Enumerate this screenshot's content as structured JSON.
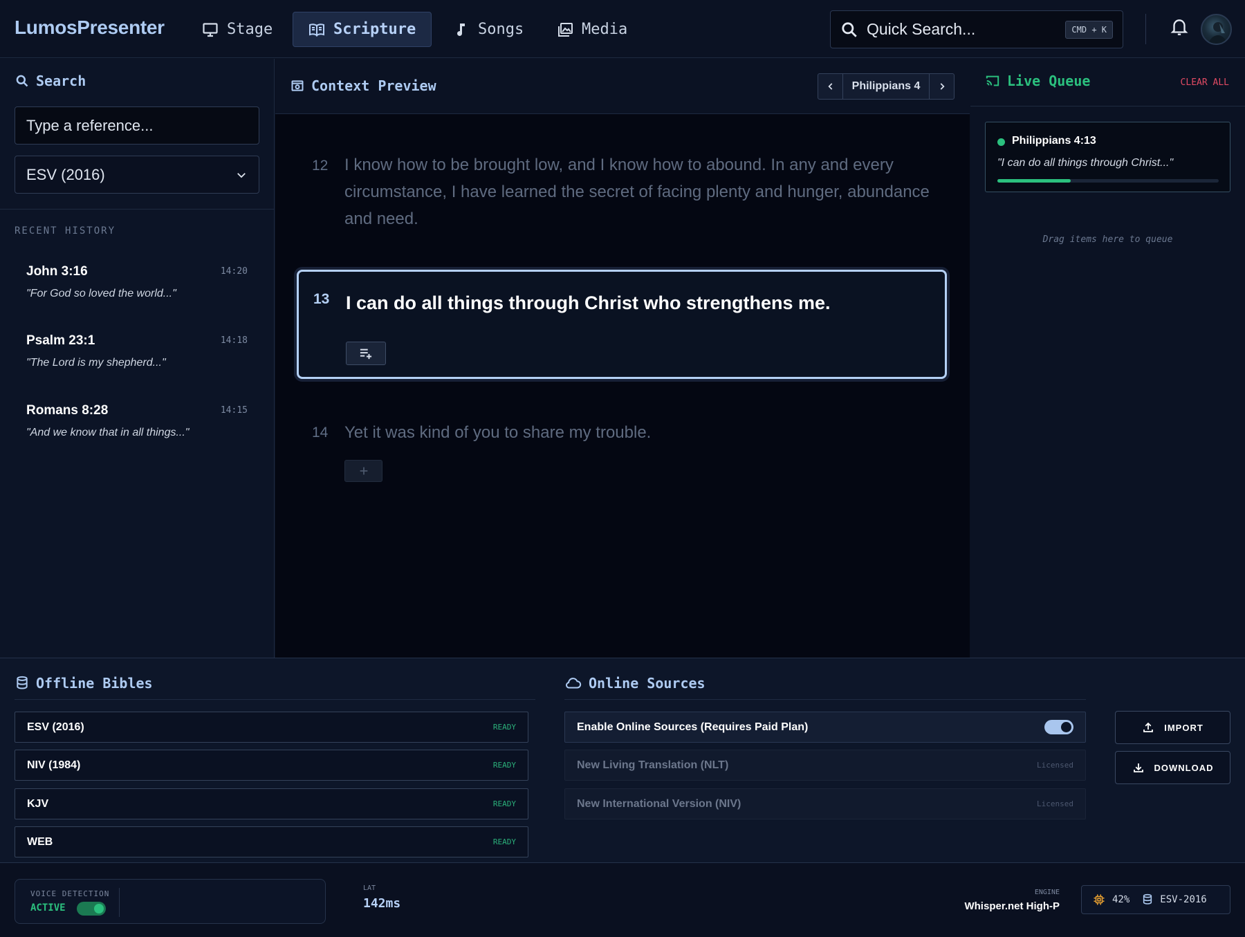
{
  "app": {
    "logo": "LumosPresenter"
  },
  "nav": {
    "tabs": [
      {
        "label": "Stage",
        "icon": "monitor-icon"
      },
      {
        "label": "Scripture",
        "icon": "book-open-icon",
        "active": true
      },
      {
        "label": "Songs",
        "icon": "music-note-icon"
      },
      {
        "label": "Media",
        "icon": "image-stack-icon"
      }
    ],
    "quick_search": {
      "text": "Quick Search...",
      "shortcut": "CMD + K"
    }
  },
  "search_panel": {
    "title": "Search",
    "reference_placeholder": "Type a reference...",
    "translation": "ESV (2016)",
    "recent_label": "RECENT HISTORY",
    "history": [
      {
        "ref": "John 3:16",
        "time": "14:20",
        "quote": "\"For God so loved the world...\""
      },
      {
        "ref": "Psalm 23:1",
        "time": "14:18",
        "quote": "\"The Lord is my shepherd...\""
      },
      {
        "ref": "Romans 8:28",
        "time": "14:15",
        "quote": "\"And we know that in all things...\""
      }
    ]
  },
  "context": {
    "title": "Context Preview",
    "chapter": "Philippians 4",
    "verses": [
      {
        "num": "12",
        "text": "I know how to be brought low, and I know how to abound. In any and every circumstance, I have learned the secret of facing plenty and hunger, abundance and need."
      },
      {
        "num": "13",
        "text": "I can do all things through Christ who strengthens me."
      },
      {
        "num": "14",
        "text": "Yet it was kind of you to share my trouble."
      }
    ],
    "active_verse": "13"
  },
  "queue": {
    "title": "Live Queue",
    "clear_label": "CLEAR ALL",
    "items": [
      {
        "ref": "Philippians 4:13",
        "quote": "\"I can do all things through Christ...\"",
        "progress": 0.33
      }
    ],
    "drag_hint": "Drag items here to queue"
  },
  "offline": {
    "title": "Offline Bibles",
    "items": [
      {
        "name": "ESV (2016)",
        "status": "READY"
      },
      {
        "name": "NIV (1984)",
        "status": "READY"
      },
      {
        "name": "KJV",
        "status": "READY"
      },
      {
        "name": "WEB",
        "status": "READY"
      }
    ]
  },
  "online": {
    "title": "Online Sources",
    "enable_label": "Enable Online Sources (Requires Paid Plan)",
    "enabled": true,
    "items": [
      {
        "name": "New Living Translation (NLT)",
        "status": "Licensed"
      },
      {
        "name": "New International Version  (NIV)",
        "status": "Licensed"
      }
    ],
    "import_label": "IMPORT",
    "download_label": "DOWNLOAD"
  },
  "status": {
    "voice_label": "VOICE DETECTION",
    "voice_state": "ACTIVE",
    "voice_on": true,
    "lat_label": "LAT",
    "lat_value": "142ms",
    "engine_label": "ENGINE",
    "engine_value": "Whisper.net High-P",
    "cpu": "42%",
    "bible": "ESV-2016"
  },
  "colors": {
    "accent": "#aecbf2",
    "live_green": "#2bc07e",
    "danger": "#e04a63",
    "background": "#0a1122"
  }
}
